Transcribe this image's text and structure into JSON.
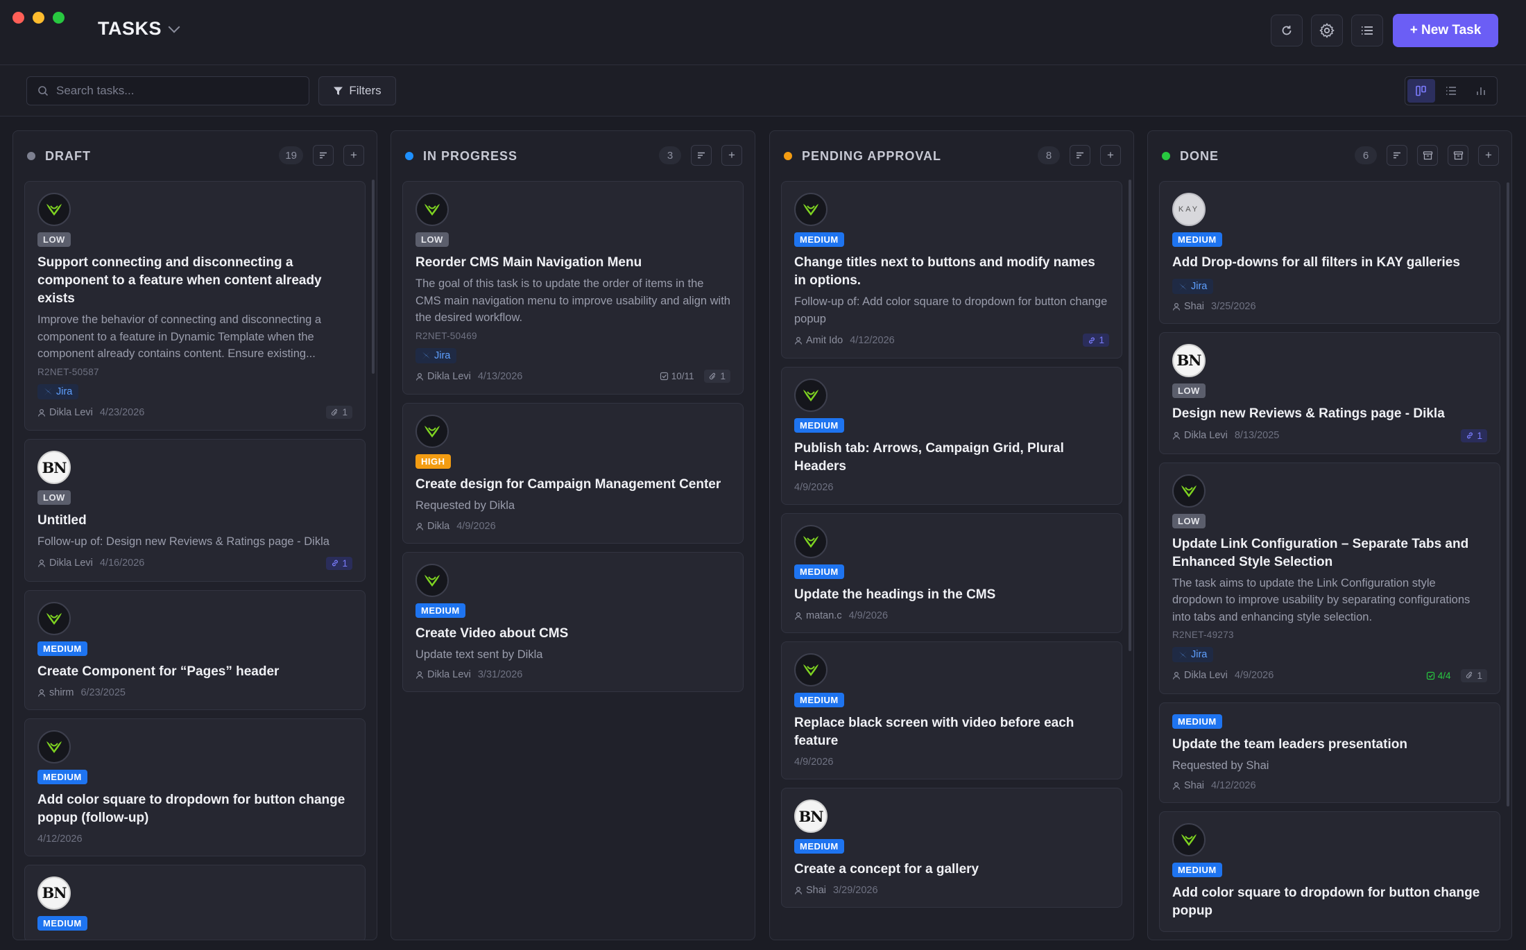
{
  "app": {
    "title": "TASKS",
    "new_task_label": "+ New Task"
  },
  "toolbar": {
    "search_placeholder": "Search tasks...",
    "filters_label": "Filters"
  },
  "colors": {
    "accent": "#6b5ef5",
    "draft": "#7d8090",
    "in_progress": "#1e90ff",
    "pending": "#f39c12",
    "done": "#28c840"
  },
  "columns": [
    {
      "title": "DRAFT",
      "count": "19",
      "cards": [
        {
          "avatar": "logo",
          "priority": "LOW",
          "title": "Support connecting and disconnecting a component to a feature when content already exists",
          "desc": "Improve the behavior of connecting and disconnecting a component to a feature in Dynamic Template when the component already contains content. Ensure existing...",
          "id": "R2NET-50587",
          "jira": "Jira",
          "person": "Dikla Levi",
          "date": "4/23/2026",
          "attach": "1"
        },
        {
          "avatar": "BN",
          "priority": "LOW",
          "title": "Untitled",
          "desc": "Follow-up of: Design new Reviews & Ratings page - Dikla",
          "person": "Dikla Levi",
          "date": "4/16/2026",
          "link": "1"
        },
        {
          "avatar": "logo",
          "priority": "MEDIUM",
          "title": "Create Component for “Pages” header",
          "person": "shirm",
          "date": "6/23/2025"
        },
        {
          "avatar": "logo",
          "priority": "MEDIUM",
          "title": "Add color square to dropdown for button change popup (follow-up)",
          "date": "4/12/2026"
        },
        {
          "avatar": "BN",
          "priority": "MEDIUM"
        }
      ]
    },
    {
      "title": "IN PROGRESS",
      "count": "3",
      "cards": [
        {
          "avatar": "logo",
          "priority": "LOW",
          "title": "Reorder CMS Main Navigation Menu",
          "desc": "The goal of this task is to update the order of items in the CMS main navigation menu to improve usability and align with the desired workflow.",
          "id": "R2NET-50469",
          "jira": "Jira",
          "person": "Dikla Levi",
          "date": "4/13/2026",
          "checklist": "10/11",
          "attach": "1"
        },
        {
          "avatar": "logo",
          "priority": "HIGH",
          "title": "Create design for Campaign Management Center",
          "desc": "Requested by Dikla",
          "person": "Dikla",
          "date": "4/9/2026"
        },
        {
          "avatar": "logo",
          "priority": "MEDIUM",
          "title": "Create Video about CMS",
          "desc": "Update text sent by Dikla",
          "person": "Dikla Levi",
          "date": "3/31/2026"
        }
      ]
    },
    {
      "title": "PENDING APPROVAL",
      "count": "8",
      "cards": [
        {
          "avatar": "logo",
          "priority": "MEDIUM",
          "title": "Change titles next to buttons and modify names in options.",
          "desc": "Follow-up of: Add color square to dropdown for button change popup",
          "person": "Amit Ido",
          "date": "4/12/2026",
          "link": "1"
        },
        {
          "avatar": "logo",
          "priority": "MEDIUM",
          "title": "Publish tab: Arrows, Campaign Grid, Plural Headers",
          "date": "4/9/2026"
        },
        {
          "avatar": "logo",
          "priority": "MEDIUM",
          "title": "Update the headings in the CMS",
          "person": "matan.c",
          "date": "4/9/2026"
        },
        {
          "avatar": "logo",
          "priority": "MEDIUM",
          "title": "Replace black screen with video before each feature",
          "date": "4/9/2026"
        },
        {
          "avatar": "BN",
          "priority": "MEDIUM",
          "title": "Create a concept for a gallery",
          "person": "Shai",
          "date": "3/29/2026"
        }
      ]
    },
    {
      "title": "DONE",
      "count": "6",
      "cards": [
        {
          "avatar": "KAY",
          "priority": "MEDIUM",
          "title": "Add Drop-downs for all filters in KAY galleries",
          "jira": "Jira",
          "person": "Shai",
          "date": "3/25/2026"
        },
        {
          "avatar": "BN",
          "priority": "LOW",
          "title": "Design new Reviews & Ratings page - Dikla",
          "person": "Dikla Levi",
          "date": "8/13/2025",
          "link": "1"
        },
        {
          "avatar": "logo",
          "priority": "LOW",
          "title": "Update Link Configuration – Separate Tabs and Enhanced Style Selection",
          "desc": "The task aims to update the Link Configuration style dropdown to improve usability by separating configurations into tabs and enhancing style selection.",
          "id": "R2NET-49273",
          "jira": "Jira",
          "person": "Dikla Levi",
          "date": "4/9/2026",
          "checklist_done": "4/4",
          "attach": "1"
        },
        {
          "priority": "MEDIUM",
          "title": "Update the team leaders presentation",
          "desc": "Requested by Shai",
          "person": "Shai",
          "date": "4/12/2026"
        },
        {
          "avatar": "logo",
          "priority": "MEDIUM",
          "title": "Add color square to dropdown for button change popup"
        }
      ]
    }
  ]
}
